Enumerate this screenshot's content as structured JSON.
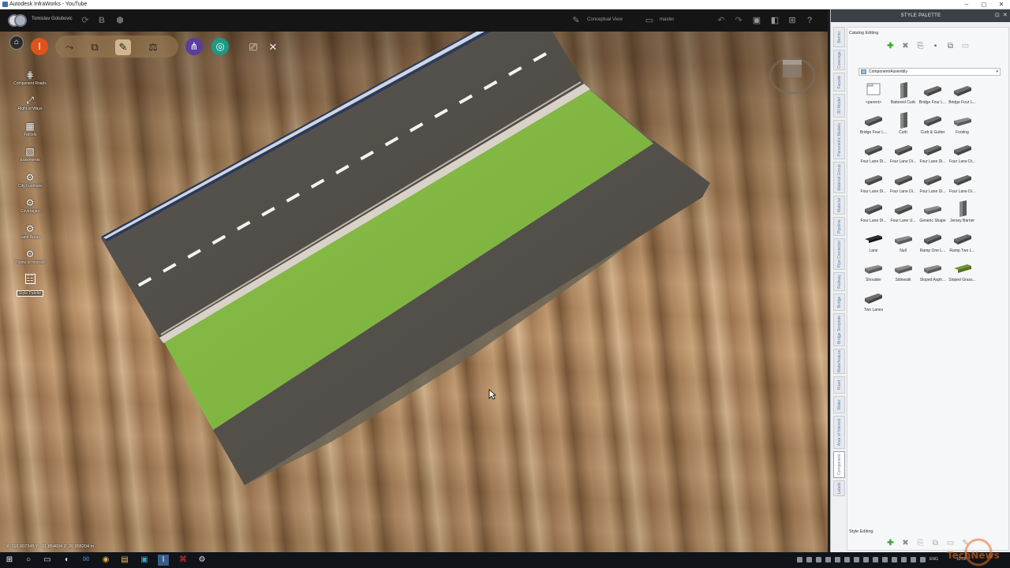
{
  "window": {
    "title": "Autodesk InfraWorks - YouTube",
    "controls": [
      "–",
      "◻",
      "✕"
    ]
  },
  "topbar": {
    "user": "Tomislav Golubovic",
    "view_label": "Conceptual View",
    "branch_label": "master"
  },
  "left_nav": {
    "items": [
      {
        "label": "Component Roads",
        "icon": "road-icon"
      },
      {
        "label": "Right of Ways",
        "icon": "right-of-way-icon"
      },
      {
        "label": "Parcels",
        "icon": "parcel-icon"
      },
      {
        "label": "Easements",
        "icon": "easement-icon"
      },
      {
        "label": "City Furniture",
        "icon": "city-furniture-icon"
      },
      {
        "label": "Coverages",
        "icon": "coverage-icon"
      },
      {
        "label": "Land Areas",
        "icon": "land-area-icon"
      },
      {
        "label": "Points of Interest",
        "icon": "point-of-interest-icon"
      },
      {
        "label": "Style Palette",
        "icon": "style-palette-icon"
      }
    ]
  },
  "viewport": {
    "coords": "X: 116.007345 Y: -31.854604 Z: 20.958204 m"
  },
  "style_palette": {
    "title": "STYLE PALETTE",
    "catalog_section": "Catalog Editing",
    "style_section": "Style Editing",
    "dropdown": "Component/Assembly",
    "vertical_tabs": [
      "Barrier",
      "Coverage",
      "Facade",
      "3D Model",
      "Parametric Models",
      "Material Group",
      "Material",
      "Pipeline",
      "Pipe Connector",
      "Railway",
      "Bridge",
      "Bridge Template",
      "Waterfeature",
      "Road",
      "Water",
      "Area of Interest",
      "Component",
      "Labels"
    ],
    "active_tab": "Component",
    "items": [
      {
        "label": "<parent>",
        "kind": "folder"
      },
      {
        "label": "Battered Curb",
        "kind": "curb"
      },
      {
        "label": "Bridge Four L...",
        "kind": "deck"
      },
      {
        "label": "Bridge Four L...",
        "kind": "deck"
      },
      {
        "label": "Bridge Four L...",
        "kind": "deck"
      },
      {
        "label": "Curb",
        "kind": "curb"
      },
      {
        "label": "Curb & Gutter",
        "kind": "deck"
      },
      {
        "label": "Footing",
        "kind": "slab"
      },
      {
        "label": "Four Lane Di...",
        "kind": "deck"
      },
      {
        "label": "Four Lane Di...",
        "kind": "deck"
      },
      {
        "label": "Four Lane Di...",
        "kind": "deck"
      },
      {
        "label": "Four Lane Di...",
        "kind": "deck"
      },
      {
        "label": "Four Lane Di...",
        "kind": "deck"
      },
      {
        "label": "Four Lane Di...",
        "kind": "deck"
      },
      {
        "label": "Four Lane Di...",
        "kind": "deck"
      },
      {
        "label": "Four Lane Di...",
        "kind": "deck"
      },
      {
        "label": "Four Lane Di...",
        "kind": "deck"
      },
      {
        "label": "Four Lane U...",
        "kind": "deck"
      },
      {
        "label": "Generic Shape",
        "kind": "slab"
      },
      {
        "label": "Jersey Barrier",
        "kind": "curb"
      },
      {
        "label": "Lane",
        "kind": "dark"
      },
      {
        "label": "Null",
        "kind": "slab"
      },
      {
        "label": "Ramp One L...",
        "kind": "deck"
      },
      {
        "label": "Ramp Two L...",
        "kind": "deck"
      },
      {
        "label": "Shoulder",
        "kind": "slab"
      },
      {
        "label": "Sidewalk",
        "kind": "slab"
      },
      {
        "label": "Sloped Asph...",
        "kind": "slab"
      },
      {
        "label": "Sloped Grass...",
        "kind": "grass"
      },
      {
        "label": "Two Lanes",
        "kind": "deck"
      }
    ]
  },
  "taskbar": {
    "tray_text": "ENG",
    "clock": "10:09"
  },
  "watermark": {
    "text": "TechNews"
  }
}
